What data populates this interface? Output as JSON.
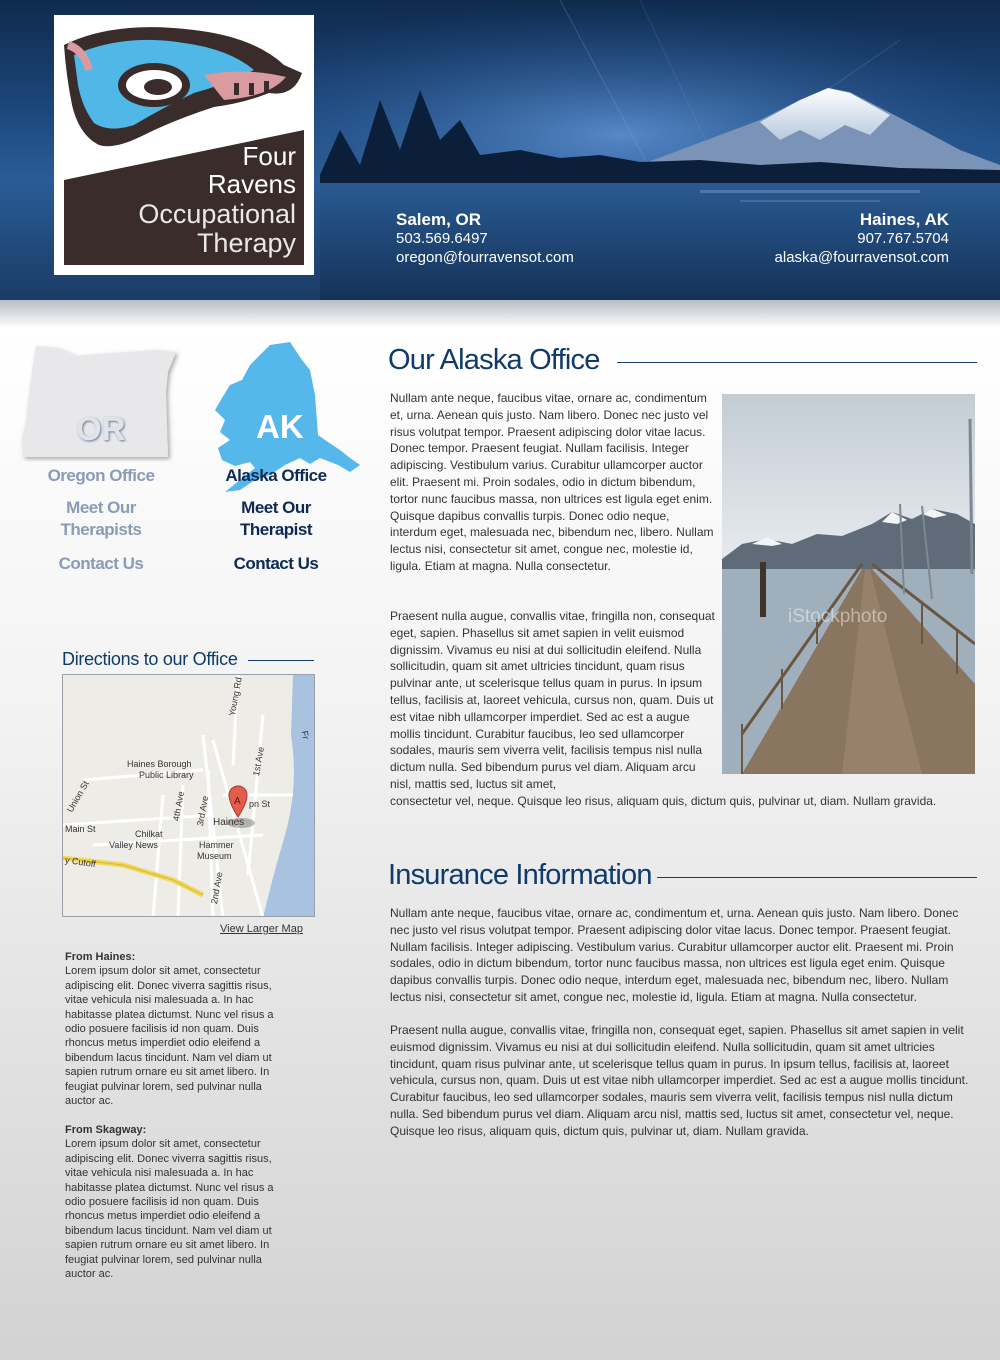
{
  "logo": {
    "line1": "Four",
    "line2": "Ravens",
    "line3": "Occupational",
    "line4": "Therapy"
  },
  "offices": {
    "oregon": {
      "city": "Salem, OR",
      "phone": "503.569.6497",
      "email": "oregon@fourravensot.com"
    },
    "alaska": {
      "city": "Haines, AK",
      "phone": "907.767.5704",
      "email": "alaska@fourravensot.com"
    }
  },
  "nav": {
    "oregon": {
      "state": "OR",
      "office": "Oregon Office",
      "meet_l1": "Meet Our",
      "meet_l2": "Therapists",
      "contact": "Contact Us"
    },
    "alaska": {
      "state": "AK",
      "office": "Alaska Office",
      "meet_l1": "Meet Our",
      "meet_l2": "Therapist",
      "contact": "Contact Us"
    }
  },
  "directions": {
    "heading": "Directions to our Office",
    "map_labels": {
      "young_rd": "Young Rd",
      "haines_borough": "Haines Borough",
      "public_library": "Public Library",
      "first_ave": "1st Ave",
      "union_st": "Union St",
      "fourth_ave": "4th Ave",
      "third_ave": "3rd Ave",
      "main_st": "Main St",
      "chilkat": "Chilkat",
      "valley_news": "Valley News",
      "haines": "Haines",
      "hammer": "Hammer",
      "museum": "Museum",
      "cutoff": "y Cutoff",
      "second_ave": "2nd Ave",
      "fr": "Fr",
      "pn_st": "pn St",
      "marker": "A"
    },
    "view_larger": "View Larger Map",
    "from_haines_title": "From Haines:",
    "from_haines_text": "Lorem ipsum dolor sit amet, consectetur adipiscing elit. Donec viverra sagittis risus, vitae vehicula nisi malesuada a. In hac habitasse platea dictumst. Nunc vel risus a odio posuere facilisis id non quam. Duis rhoncus metus imperdiet odio eleifend a bibendum lacus tincidunt. Nam vel diam ut sapien rutrum ornare eu sit amet libero. In feugiat pulvinar lorem, sed pulvinar nulla auctor ac.",
    "from_skagway_title": "From Skagway:",
    "from_skagway_text": "Lorem ipsum dolor sit amet, consectetur adipiscing elit. Donec viverra sagittis risus, vitae vehicula nisi malesuada a. In hac habitasse platea dictumst. Nunc vel risus a odio posuere facilisis id non quam. Duis rhoncus metus imperdiet odio eleifend a bibendum lacus tincidunt. Nam vel diam ut sapien rutrum ornare eu sit amet libero. In feugiat pulvinar lorem, sed pulvinar nulla auctor ac."
  },
  "alaska_office": {
    "heading": "Our Alaska Office",
    "photo_watermark": "iStockphoto",
    "para1": "Nullam ante neque, faucibus vitae, ornare ac, condimentum et, urna. Aenean quis justo. Nam libero. Donec nec justo vel risus volutpat tempor. Praesent adipiscing dolor vitae lacus. Donec tempor. Praesent feugiat. Nullam facilisis. Integer adipiscing. Vestibulum varius. Curabitur ullamcorper auctor elit. Praesent mi. Proin sodales, odio in dictum bibendum, tortor nunc faucibus massa, non ultrices est ligula eget enim. Quisque dapibus convallis turpis. Donec odio neque, interdum eget, malesuada nec, bibendum nec, libero. Nullam lectus nisi, consectetur sit amet, congue nec, molestie id, ligula. Etiam at magna. Nulla consectetur.",
    "para2": "Praesent nulla augue, convallis vitae, fringilla non, consequat eget, sapien. Phasellus sit amet sapien in velit euismod dignissim. Vivamus eu nisi at dui sollicitudin eleifend. Nulla sollicitudin, quam sit amet ultricies tincidunt, quam risus pulvinar ante, ut scelerisque tellus quam in purus. In ipsum tellus, facilisis at, laoreet vehicula, cursus non, quam. Duis ut est vitae nibh ullamcorper imperdiet. Sed ac est a augue mollis tincidunt. Curabitur faucibus, leo sed ullamcorper sodales, mauris sem viverra velit, facilisis tempus nisl nulla dictum nulla. Sed bibendum purus vel diam. Aliquam arcu nisl, mattis sed, luctus sit amet,",
    "para2_tail": "consectetur vel, neque. Quisque leo risus, aliquam quis, dictum quis, pulvinar ut, diam. Nullam gravida."
  },
  "insurance": {
    "heading": "Insurance Information",
    "para1": "Nullam ante neque, faucibus vitae, ornare ac, condimentum et, urna. Aenean quis justo. Nam libero. Donec nec justo vel risus volutpat tempor. Praesent adipiscing dolor vitae lacus. Donec tempor. Praesent feugiat. Nullam facilisis. Integer adipiscing. Vestibulum varius. Curabitur ullamcorper auctor elit. Praesent mi. Proin sodales, odio in dictum bibendum, tortor nunc faucibus massa, non ultrices est ligula eget enim. Quisque dapibus convallis turpis. Donec odio neque, interdum eget, malesuada nec, bibendum nec, libero. Nullam lectus nisi, consectetur sit amet, congue nec, molestie id, ligula. Etiam at magna. Nulla consectetur.",
    "para2": "Praesent nulla augue, convallis vitae, fringilla non, consequat eget, sapien. Phasellus sit amet sapien in velit euismod dignissim. Vivamus eu nisi at dui sollicitudin eleifend. Nulla sollicitudin, quam sit amet ultricies tincidunt, quam risus pulvinar ante, ut scelerisque tellus quam in purus. In ipsum tellus, facilisis at, laoreet vehicula, cursus non, quam. Duis ut est vitae nibh ullamcorper imperdiet. Sed ac est a augue mollis tincidunt. Curabitur faucibus, leo sed ullamcorper sodales, mauris sem viverra velit, facilisis tempus nisl nulla dictum nulla. Sed bibendum purus vel diam. Aliquam arcu nisl, mattis sed, luctus sit amet, consectetur vel, neque. Quisque leo risus, aliquam quis, dictum quis, pulvinar ut, diam. Nullam gravida."
  },
  "colors": {
    "header_dark": "#0f2a4d",
    "heading_blue": "#0f3a6a",
    "alaska_blue": "#55b7ea",
    "logo_brown": "#3a2c2a",
    "logo_teal": "#4fb8e6"
  }
}
